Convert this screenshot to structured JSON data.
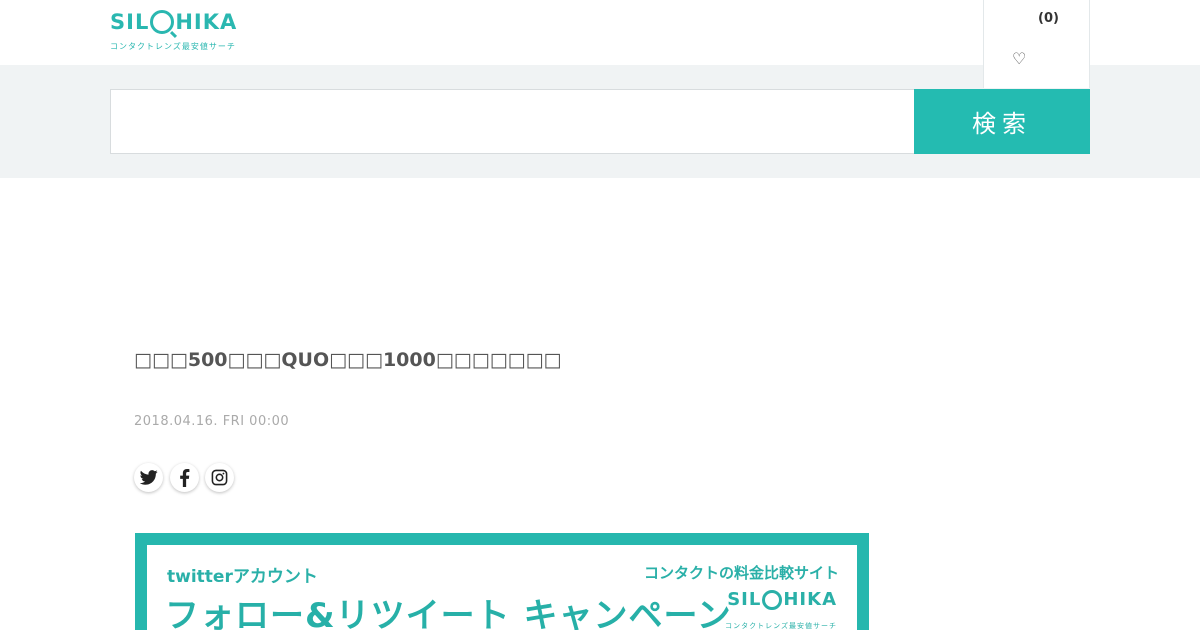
{
  "header": {
    "logo_text_left": "SIL",
    "logo_text_right": "HIKA",
    "logo_tagline": "コンタクトレンズ最安値サーチ",
    "favorites_count": "(0)",
    "favorites_icon": "heart-outline-icon"
  },
  "search": {
    "value": "",
    "placeholder": "",
    "button_label": "検索"
  },
  "article": {
    "title": "□□□500□□□QUO□□□1000□□□□□□□",
    "date": "2018.04.16. FRI 00:00",
    "share": [
      {
        "icon": "twitter-icon"
      },
      {
        "icon": "facebook-icon"
      },
      {
        "icon": "instagram-icon"
      }
    ]
  },
  "banner": {
    "subtitle": "twitterアカウント",
    "headline": "フォロー&リツイート キャンペーン",
    "right_text": "コンタクトの料金比較サイト",
    "logo_text_left": "SIL",
    "logo_text_right": "HIKA",
    "logo_tagline": "コンタクトレンズ最安値サーチ"
  },
  "colors": {
    "accent": "#24bbb1",
    "search_band_bg": "#f0f3f4",
    "date_text": "#aaaaaa"
  }
}
